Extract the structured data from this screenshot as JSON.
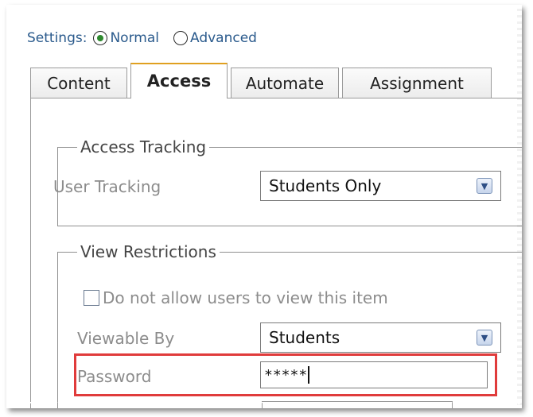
{
  "settings": {
    "label": "Settings:",
    "options": [
      {
        "label": "Normal",
        "selected": true
      },
      {
        "label": "Advanced",
        "selected": false
      }
    ]
  },
  "tabs": [
    {
      "label": "Content",
      "active": false
    },
    {
      "label": "Access",
      "active": true
    },
    {
      "label": "Automate",
      "active": false
    },
    {
      "label": "Assignment",
      "active": false
    }
  ],
  "access_tracking": {
    "legend": "Access Tracking",
    "user_tracking": {
      "label": "User Tracking",
      "value": "Students Only"
    }
  },
  "view_restrictions": {
    "legend": "View Restrictions",
    "disallow_view": {
      "label": "Do not allow users to view this item",
      "checked": false
    },
    "viewable_by": {
      "label": "Viewable By",
      "value": "Students"
    },
    "password": {
      "label": "Password",
      "value": "*****"
    }
  },
  "colors": {
    "highlight": "#e03b3b",
    "settings_text": "#2a5a8c",
    "active_tab_accent": "#e0a020"
  }
}
